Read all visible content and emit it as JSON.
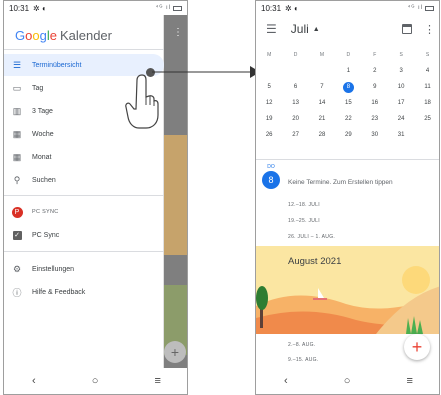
{
  "left_phone": {
    "status": {
      "time": "10:31",
      "icons": "✲ ◐",
      "network": "⁴ᴳ ıl"
    },
    "brand": {
      "g1": "G",
      "g2": "o",
      "g3": "o",
      "g4": "g",
      "g5": "l",
      "g6": "e",
      "product": "Kalender"
    },
    "menu": {
      "terminuebersicht": "Terminübersicht",
      "tag": "Tag",
      "drei_tage": "3 Tage",
      "woche": "Woche",
      "monat": "Monat",
      "suchen": "Suchen",
      "pc_sync_header": "PC SYNC",
      "pc_sync_avatar": "P",
      "pc_sync_item": "PC Sync",
      "einstellungen": "Einstellungen",
      "hilfe": "Hilfe & Feedback"
    },
    "nav": {
      "back": "‹",
      "home": "○",
      "recents": "≡"
    }
  },
  "right_phone": {
    "status": {
      "time": "10:31",
      "icons": "✲ ◐",
      "network": "⁴ᴳ ıl"
    },
    "appbar": {
      "month": "Juli",
      "caret": "▲"
    },
    "weekdays": [
      "M",
      "D",
      "M",
      "D",
      "F",
      "S",
      "S"
    ],
    "weeks": [
      [
        "",
        "",
        "",
        "1",
        "2",
        "3",
        "4"
      ],
      [
        "5",
        "6",
        "7",
        "8",
        "9",
        "10",
        "11"
      ],
      [
        "12",
        "13",
        "14",
        "15",
        "16",
        "17",
        "18"
      ],
      [
        "19",
        "20",
        "21",
        "22",
        "23",
        "24",
        "25"
      ],
      [
        "26",
        "27",
        "28",
        "29",
        "30",
        "31",
        ""
      ]
    ],
    "today": "8",
    "day": {
      "weekday": "DO",
      "number": "8",
      "no_events": "Keine Termine. Zum Erstellen tippen"
    },
    "week_ranges": [
      "12.–18. JULI",
      "19.–25. JULI",
      "26. JULI – 1. AUG."
    ],
    "banner_title": "August 2021",
    "aug_weeks": [
      "2.–8. AUG.",
      "9.–15. AUG."
    ],
    "fab": "+",
    "nav": {
      "back": "‹",
      "home": "○",
      "recents": "≡"
    }
  },
  "colors": {
    "accent": "#1a73e8",
    "active_bg": "#e8f0fe",
    "fab_plus": "#ea4335"
  }
}
